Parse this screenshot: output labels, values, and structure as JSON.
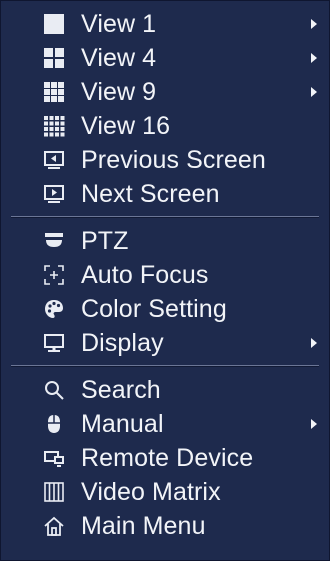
{
  "colors": {
    "background": "#1e2a4d",
    "text": "#f2f4f8",
    "separator": "#6b7696"
  },
  "menu": {
    "groups": [
      {
        "items": [
          {
            "label": "View 1",
            "icon": "view-1-icon",
            "submenu": true
          },
          {
            "label": "View 4",
            "icon": "view-4-icon",
            "submenu": true
          },
          {
            "label": "View 9",
            "icon": "view-9-icon",
            "submenu": true
          },
          {
            "label": "View 16",
            "icon": "view-16-icon",
            "submenu": false
          },
          {
            "label": "Previous Screen",
            "icon": "previous-screen-icon",
            "submenu": false
          },
          {
            "label": "Next Screen",
            "icon": "next-screen-icon",
            "submenu": false
          }
        ]
      },
      {
        "items": [
          {
            "label": "PTZ",
            "icon": "ptz-icon",
            "submenu": false
          },
          {
            "label": "Auto Focus",
            "icon": "auto-focus-icon",
            "submenu": false
          },
          {
            "label": "Color Setting",
            "icon": "color-palette-icon",
            "submenu": false
          },
          {
            "label": "Display",
            "icon": "display-monitor-icon",
            "submenu": true
          }
        ]
      },
      {
        "items": [
          {
            "label": "Search",
            "icon": "search-icon",
            "submenu": false
          },
          {
            "label": "Manual",
            "icon": "manual-mouse-icon",
            "submenu": true
          },
          {
            "label": "Remote Device",
            "icon": "remote-device-icon",
            "submenu": false
          },
          {
            "label": "Video Matrix",
            "icon": "video-matrix-icon",
            "submenu": false
          },
          {
            "label": "Main Menu",
            "icon": "home-icon",
            "submenu": false
          }
        ]
      }
    ]
  }
}
